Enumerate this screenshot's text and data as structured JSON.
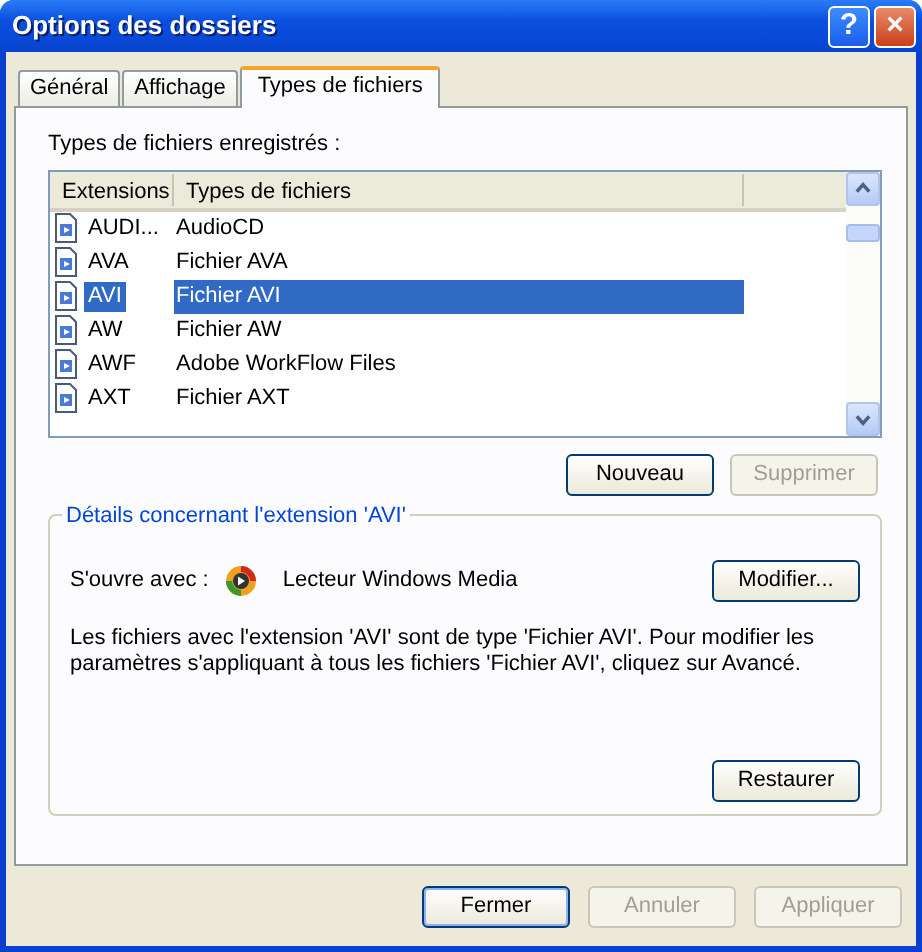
{
  "window": {
    "title": "Options des dossiers"
  },
  "title_buttons": [
    {
      "label": "?",
      "kind": "help"
    },
    {
      "label": "×",
      "kind": "close"
    }
  ],
  "tabs": [
    {
      "label": "Général",
      "selected": false
    },
    {
      "label": "Affichage",
      "selected": false
    },
    {
      "label": "Types de fichiers",
      "selected": true
    }
  ],
  "registered_label": "Types de fichiers enregistrés :",
  "table": {
    "columns": [
      "Extensions",
      "Types de fichiers"
    ],
    "rows": [
      {
        "extension": "AUDI...",
        "type": "AudioCD",
        "selected": false
      },
      {
        "extension": "AVA",
        "type": "Fichier AVA",
        "selected": false
      },
      {
        "extension": "AVI",
        "type": "Fichier AVI",
        "selected": true
      },
      {
        "extension": "AW",
        "type": "Fichier AW",
        "selected": false
      },
      {
        "extension": "AWF",
        "type": "Adobe WorkFlow Files",
        "selected": false
      },
      {
        "extension": "AXT",
        "type": "Fichier AXT",
        "selected": false
      }
    ]
  },
  "list_buttons": [
    {
      "label": "Nouveau",
      "disabled": false
    },
    {
      "label": "Supprimer",
      "disabled": true
    }
  ],
  "details": {
    "legend": "Détails concernant l'extension 'AVI'",
    "opens_with_label": "S'ouvre avec :",
    "opens_with_app": "Lecteur Windows Media",
    "change_button": {
      "label": "Modifier...",
      "disabled": false
    },
    "description": "Les fichiers avec l'extension 'AVI' sont de type 'Fichier AVI'. Pour modifier les paramètres s'appliquant à tous les fichiers 'Fichier AVI', cliquez sur Avancé.",
    "restore_button": {
      "label": "Restaurer",
      "disabled": false
    }
  },
  "footer_buttons": [
    {
      "label": "Fermer",
      "disabled": false,
      "default": true
    },
    {
      "label": "Annuler",
      "disabled": true,
      "default": false
    },
    {
      "label": "Appliquer",
      "disabled": true,
      "default": false
    }
  ]
}
